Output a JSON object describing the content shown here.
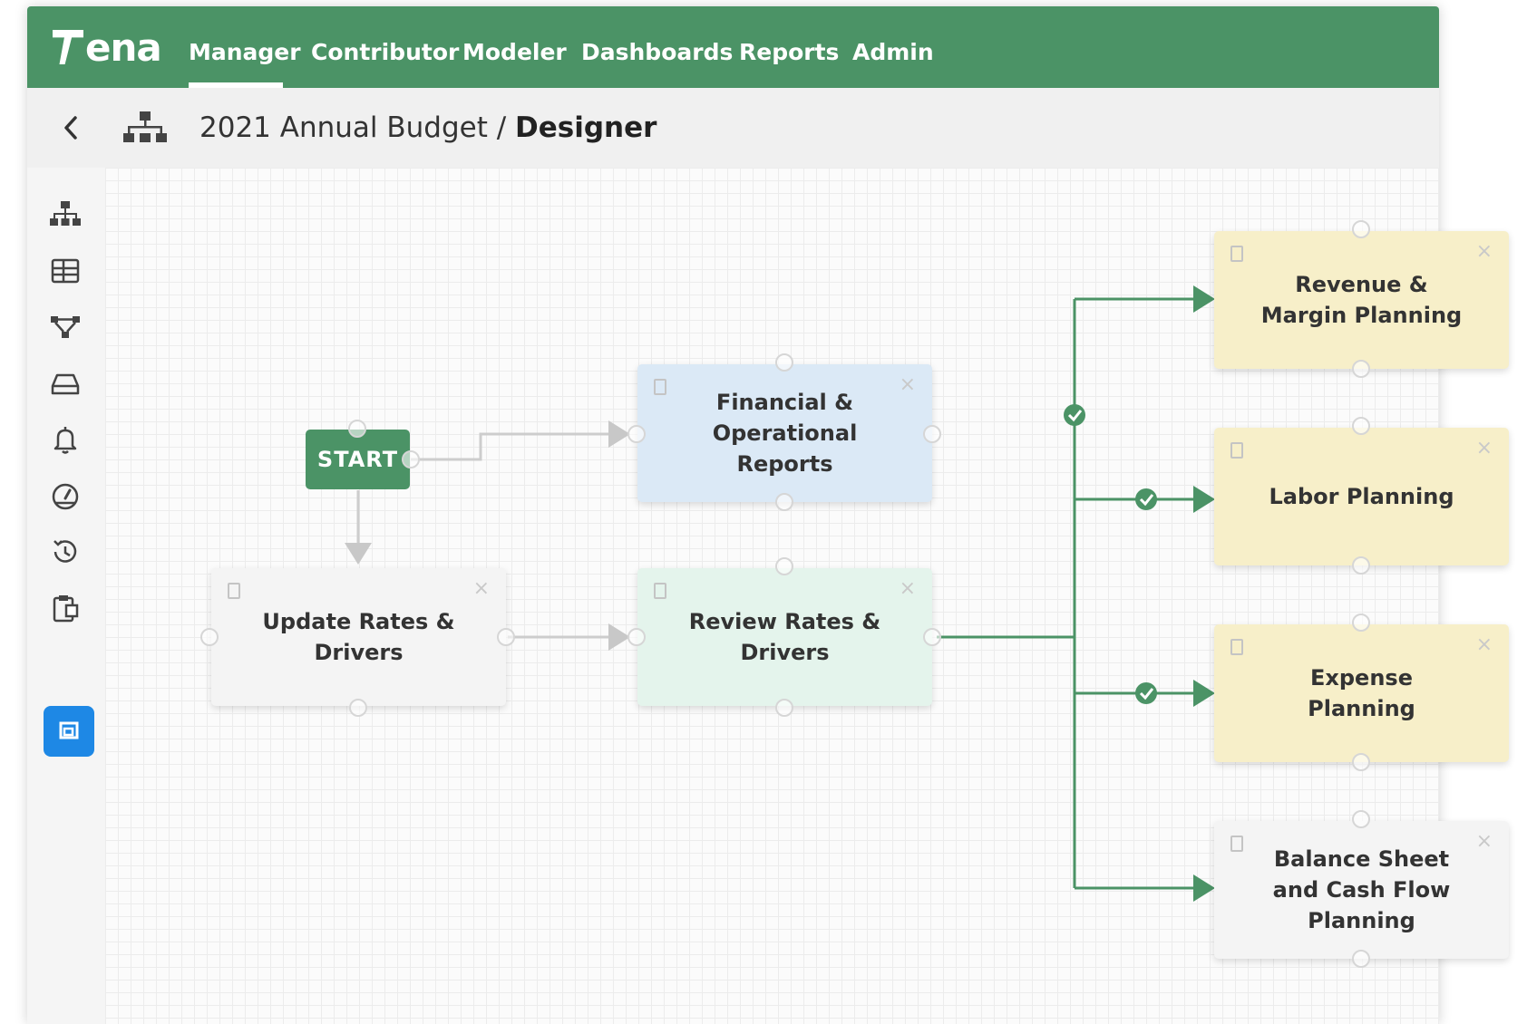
{
  "app": {
    "logo_text": "ena"
  },
  "nav": {
    "tabs": [
      {
        "label": "Manager",
        "active": true
      },
      {
        "label": "Contributor"
      },
      {
        "label": "Modeler"
      },
      {
        "label": "Dashboards"
      },
      {
        "label": "Reports"
      },
      {
        "label": "Admin"
      }
    ]
  },
  "breadcrumb": {
    "parent": "2021 Annual Budget",
    "separator": " / ",
    "current": "Designer"
  },
  "sidebar": {
    "items": [
      {
        "icon": "hierarchy-icon"
      },
      {
        "icon": "table-grid-icon"
      },
      {
        "icon": "workflow-icon"
      },
      {
        "icon": "inbox-tray-icon"
      },
      {
        "icon": "bell-icon"
      },
      {
        "icon": "speedometer-icon"
      },
      {
        "icon": "history-icon"
      },
      {
        "icon": "clipboard-icon"
      },
      {
        "icon": "designer-icon",
        "active": true
      }
    ]
  },
  "workflow": {
    "start_label": "START",
    "nodes": {
      "financial_reports": "Financial &\nOperational\nReports",
      "update_rates": "Update Rates &\nDrivers",
      "review_rates": "Review Rates &\nDrivers",
      "revenue_margin": "Revenue &\nMargin Planning",
      "labor": "Labor Planning",
      "expense": "Expense\nPlanning",
      "balance_sheet": "Balance Sheet\nand Cash Flow\nPlanning"
    },
    "close_glyph": "×"
  },
  "colors": {
    "brand_green": "#4b9366",
    "active_blue": "#1e88e5",
    "node_blue": "#dbe9f6",
    "node_green": "#e4f4ec",
    "node_yellow": "#f7efc9",
    "node_grey": "#f4f4f4"
  }
}
